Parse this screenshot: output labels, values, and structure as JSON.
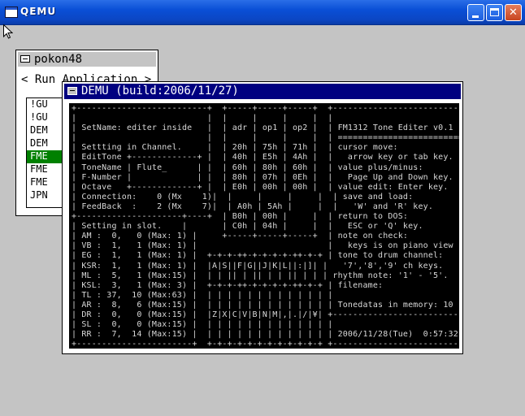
{
  "host_window": {
    "title": "QEMU",
    "buttons": {
      "minimize": "",
      "maximize": "",
      "close": "✕"
    }
  },
  "pokon_window": {
    "title": "pokon48",
    "subtitle": "< Run Application >",
    "items": [
      {
        "label": "!GU",
        "selected": false
      },
      {
        "label": "!GU",
        "selected": false
      },
      {
        "label": "DEM",
        "selected": false
      },
      {
        "label": "DEM",
        "selected": false
      },
      {
        "label": "FME",
        "selected": true
      },
      {
        "label": "FME",
        "selected": false
      },
      {
        "label": "FME",
        "selected": false
      },
      {
        "label": "JPN",
        "selected": false
      }
    ]
  },
  "demu_window": {
    "title": "DEMU (build:2006/11/27)",
    "terminal_lines": [
      "+--------------------------+  +-----+-----+-----+  +----------------------------+",
      "|                          |  |     |     |     |  |                            |",
      "| SetName: editer inside   |  | adr | op1 | op2 |  | FM1312 Tone Editer v0.1    |",
      "|                          |  |     |     |     |  | ========================== |",
      "| Settting in Channel.     |  | 20h | 75h | 71h |  | cursor move:               |",
      "| EditTone +-------------+ |  | 40h | E5h | 4Ah |  |   arrow key or tab key.    |",
      "| ToneName | Flute_      | |  | 60h | 80h | 60h |  | value plus/minus:          |",
      "| F-Number |             | |  | 80h | 07h | 0Eh |  |   Page Up and Down key.    |",
      "| Octave   +-------------+ |  | E0h | 00h | 00h |  | value edit: Enter key.     |",
      "| Connection:    0 (Mx    1)|  |     |     |     |  | save and load:             |",
      "| FeedBack  :    2 (Mx    7)|  | A0h | 5Ah |     |  |   'W' and 'R' key.         |",
      "+---------------------+----+  | B0h | 00h |     |  | return to DOS:             |",
      "| Setting in slot.    |       | C0h | 04h |     |  |   ESC or 'Q' key.          |",
      "| AM :  0,   0 (Max: 1) |     +-----+-----+-----+  | note on check:             |",
      "| VB :  1,   1 (Max: 1) |                          |   keys is on piano view    |",
      "| EG :  1,   1 (Max: 1) |  +-+-+-++-+-+-+-+-++-+-+ | tone to drum channel:      |",
      "| KSR:  1,   1 (Max: 1) |  |A|S||F|G||J|K|L||:|]| |   '7','8','9' ch keys.     |",
      "| ML :  5,   1 (Max:15) |  | | || | || | | || | | | rhythm note: '1' - '5'.    |",
      "| KSL:  3,   1 (Max: 3) |  +-+-+-++-+-+-+-+-++-+-+ | filename:                  |",
      "| TL : 37,  10 (Max:63) |  | | | | | | | | | | | | |                            |",
      "| AR :  8,   6 (Max:15) |  | | | | | | | | | | | | | Tonedatas in memory: 10    |",
      "| DR :  0,   0 (Max:15) |  |Z|X|C|V|B|N|M|,|.|/|¥| +----------------------------+",
      "| SL :  0,   0 (Max:15) |  | | | | | | | | | | | | |                            |",
      "| RR :  7,  14 (Max:15) |  | | | | | | | | | | | | | 2006/11/28(Tue)  0:57:32   |",
      "+-----------------------+  +-+-+-+-+-+-+-+-+-+-+-+ +----------------------------+"
    ]
  }
}
